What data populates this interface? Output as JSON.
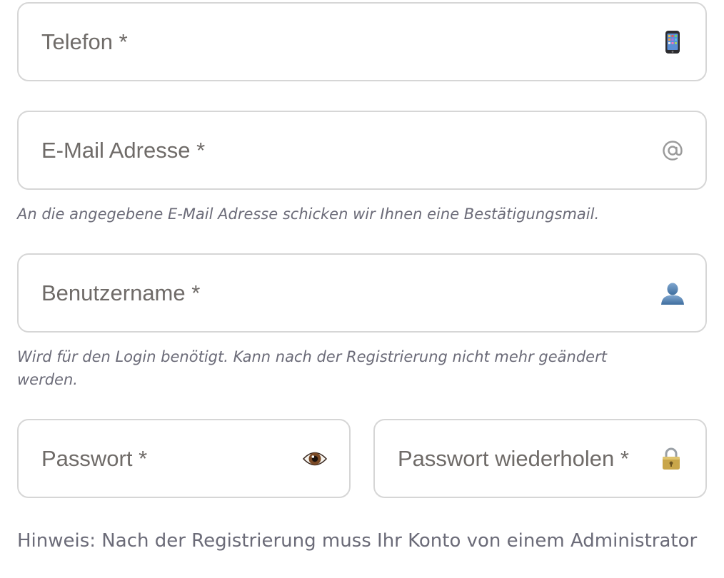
{
  "fields": {
    "phone": {
      "placeholder": "Telefon *",
      "value": "",
      "icon": "mobile-phone-icon"
    },
    "email": {
      "placeholder": "E-Mail Adresse *",
      "value": "",
      "icon": "at-sign-icon",
      "help": "An die angegebene E-Mail Adresse schicken wir Ihnen eine Bestätigungsmail."
    },
    "username": {
      "placeholder": "Benutzername *",
      "value": "",
      "icon": "user-icon",
      "help": "Wird für den Login benötigt. Kann nach der Registrierung nicht mehr geändert werden."
    },
    "password": {
      "placeholder": "Passwort *",
      "value": "",
      "icon": "eye-icon"
    },
    "password_repeat": {
      "placeholder": "Passwort wiederholen *",
      "value": "",
      "icon": "lock-icon"
    }
  },
  "note": "Hinweis: Nach der Registrierung muss Ihr Konto von einem Administrator"
}
